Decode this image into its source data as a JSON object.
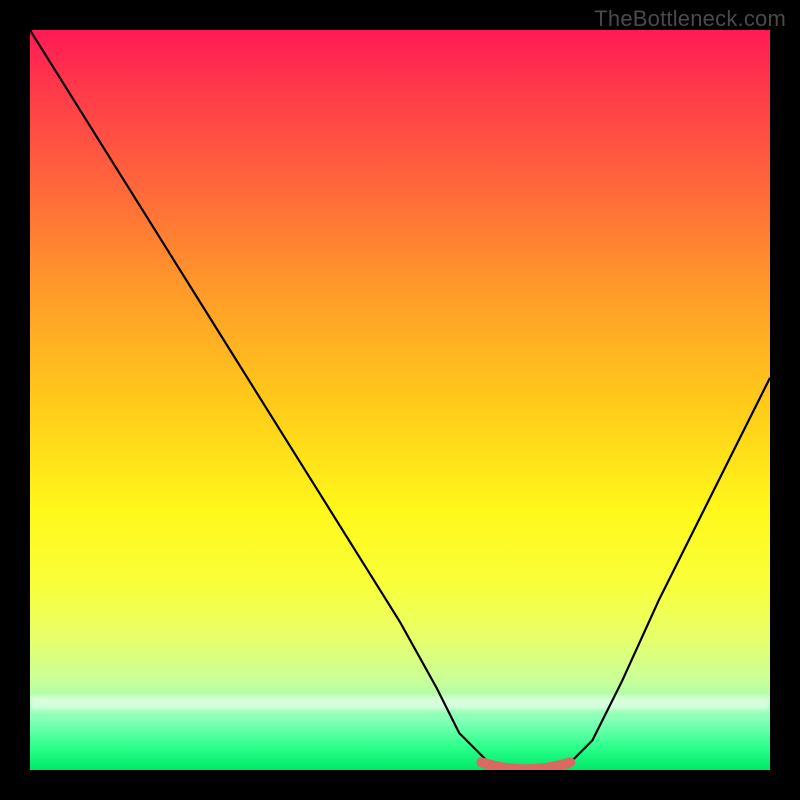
{
  "watermark": "TheBottleneck.com",
  "chart_data": {
    "type": "line",
    "title": "",
    "xlabel": "",
    "ylabel": "",
    "xlim": [
      0,
      100
    ],
    "ylim": [
      0,
      100
    ],
    "series": [
      {
        "name": "bottleneck-curve",
        "x": [
          0,
          5,
          10,
          15,
          20,
          25,
          30,
          35,
          40,
          45,
          50,
          55,
          58,
          62,
          66,
          70,
          73,
          76,
          80,
          85,
          90,
          95,
          100
        ],
        "values": [
          100,
          92,
          84,
          76,
          68,
          60,
          52,
          44,
          36,
          28,
          20,
          11,
          5,
          1,
          0.5,
          0.5,
          1,
          4,
          12,
          23,
          33,
          43,
          53
        ]
      }
    ],
    "annotations": [
      {
        "name": "optimal-range-marker",
        "x_start": 61,
        "x_end": 73,
        "y": 0.5,
        "color": "#d86a62"
      }
    ],
    "background": {
      "type": "vertical-gradient",
      "stops": [
        {
          "pos": 0.0,
          "color": "#ff1a55"
        },
        {
          "pos": 0.5,
          "color": "#ffc91a"
        },
        {
          "pos": 0.75,
          "color": "#f8ff3a"
        },
        {
          "pos": 1.0,
          "color": "#00e868"
        }
      ]
    }
  }
}
